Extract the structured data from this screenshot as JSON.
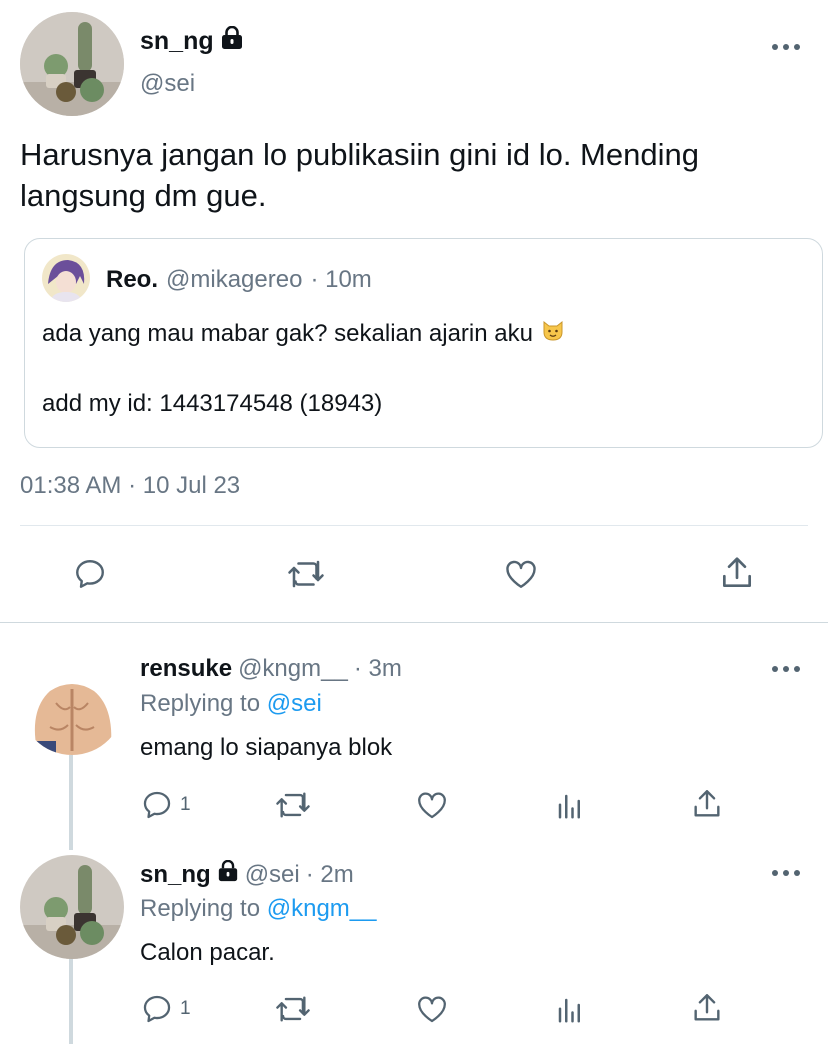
{
  "main_tweet": {
    "display_name": "sn_ng",
    "handle": "@sei",
    "text": "Harusnya jangan lo publikasiin gini id lo. Mending langsung dm gue.",
    "timestamp": "01:38 AM · 10 Jul 23",
    "quote": {
      "display_name": "Reo.",
      "handle": "@mikagereo",
      "time": "· 10m",
      "line1": "ada yang mau mabar gak? sekalian ajarin aku",
      "line2": "add my id: 1443174548 (18943)"
    }
  },
  "replies": [
    {
      "display_name": "rensuke",
      "handle": "@kngm__",
      "time": "· 3m",
      "replying_prefix": "Replying to",
      "replying_to": "@sei",
      "text": "emang lo siapanya blok",
      "reply_count": "1"
    },
    {
      "display_name": "sn_ng",
      "handle": "@sei",
      "time": "· 2m",
      "replying_prefix": "Replying to",
      "replying_to": "@kngm__",
      "text": "Calon pacar.",
      "reply_count": "1"
    }
  ],
  "icons": [
    "lock-icon",
    "more-icon",
    "reply-icon",
    "retweet-icon",
    "like-icon",
    "share-icon",
    "analytics-icon",
    "cat-emoji-icon"
  ],
  "colors": {
    "link": "#1d9bf0",
    "secondary": "#687684",
    "divider": "#e1e8ed"
  }
}
